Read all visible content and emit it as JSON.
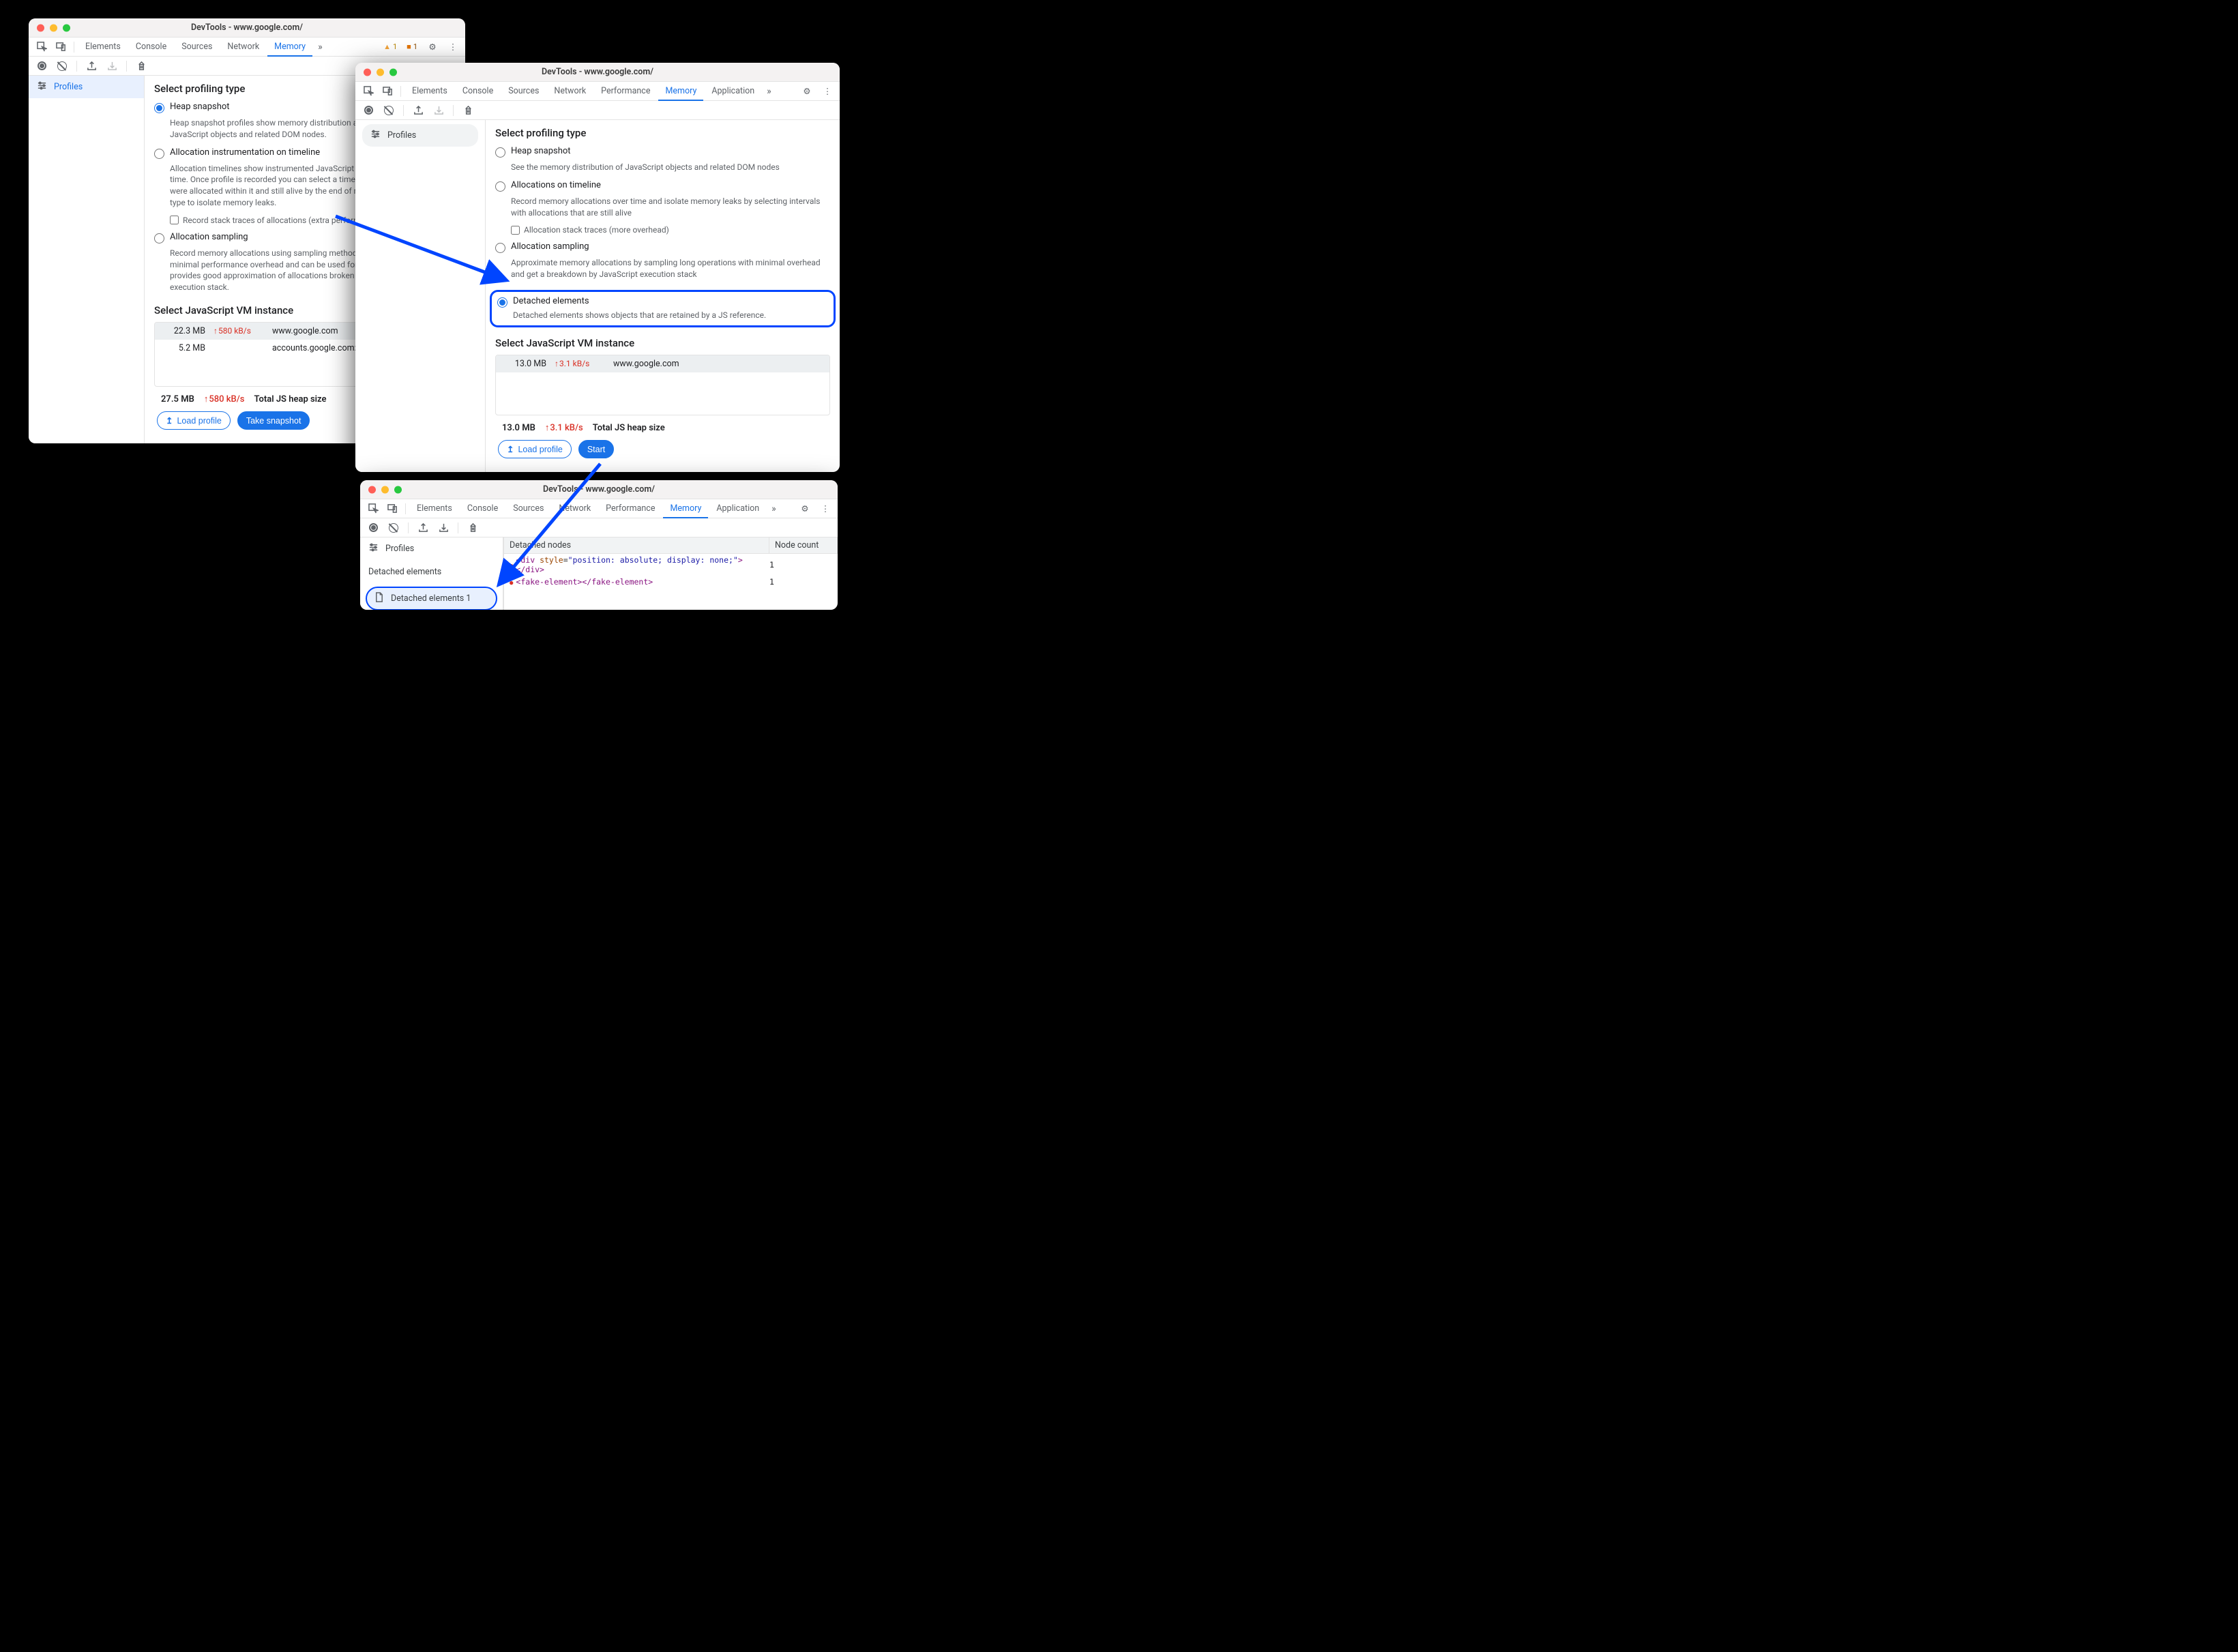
{
  "window1": {
    "title": "DevTools - www.google.com/",
    "tabs": [
      "Elements",
      "Console",
      "Sources",
      "Network",
      "Memory"
    ],
    "active_tab": "Memory",
    "warn_count": "1",
    "issue_count": "1",
    "sidebar": {
      "profiles": "Profiles"
    },
    "section_title": "Select profiling type",
    "options": [
      {
        "label": "Heap snapshot",
        "checked": true,
        "desc": "Heap snapshot profiles show memory distribution among your page's JavaScript objects and related DOM nodes."
      },
      {
        "label": "Allocation instrumentation on timeline",
        "checked": false,
        "desc": "Allocation timelines show instrumented JavaScript memory allocations over time. Once profile is recorded you can select a time interval to see objects that were allocated within it and still alive by the end of recording. Use this profile type to isolate memory leaks.",
        "sub_check": "Record stack traces of allocations (extra performance overhead)"
      },
      {
        "label": "Allocation sampling",
        "checked": false,
        "desc": "Record memory allocations using sampling method. This profile type has minimal performance overhead and can be used for long running operations. It provides good approximation of allocations broken down by JavaScript execution stack."
      }
    ],
    "vm_title": "Select JavaScript VM instance",
    "vms": [
      {
        "size": "22.3 MB",
        "rate": "580 kB/s",
        "host": "www.google.com",
        "selected": true
      },
      {
        "size": "5.2 MB",
        "rate": "",
        "host": "accounts.google.com: Rotate cookies",
        "selected": false
      }
    ],
    "footer": {
      "size": "27.5 MB",
      "rate": "580 kB/s",
      "label": "Total JS heap size",
      "load": "Load profile",
      "action": "Take snapshot"
    }
  },
  "window2": {
    "title": "DevTools - www.google.com/",
    "tabs": [
      "Elements",
      "Console",
      "Sources",
      "Network",
      "Performance",
      "Memory",
      "Application"
    ],
    "active_tab": "Memory",
    "sidebar": {
      "profiles": "Profiles"
    },
    "section_title": "Select profiling type",
    "options": [
      {
        "label": "Heap snapshot",
        "desc": "See the memory distribution of JavaScript objects and related DOM nodes"
      },
      {
        "label": "Allocations on timeline",
        "desc": "Record memory allocations over time and isolate memory leaks by selecting intervals with allocations that are still alive",
        "sub_check": "Allocation stack traces (more overhead)"
      },
      {
        "label": "Allocation sampling",
        "desc": "Approximate memory allocations by sampling long operations with minimal overhead and get a breakdown by JavaScript execution stack"
      },
      {
        "label": "Detached elements",
        "desc": "Detached elements shows objects that are retained by a JS reference.",
        "checked": true,
        "highlight": true
      }
    ],
    "vm_title": "Select JavaScript VM instance",
    "vms": [
      {
        "size": "13.0 MB",
        "rate": "3.1 kB/s",
        "host": "www.google.com",
        "selected": true
      }
    ],
    "footer": {
      "size": "13.0 MB",
      "rate": "3.1 kB/s",
      "label": "Total JS heap size",
      "load": "Load profile",
      "action": "Start"
    }
  },
  "window3": {
    "title": "DevTools - www.google.com/",
    "tabs": [
      "Elements",
      "Console",
      "Sources",
      "Network",
      "Performance",
      "Memory",
      "Application"
    ],
    "active_tab": "Memory",
    "sidebar": {
      "profiles": "Profiles",
      "category": "Detached elements",
      "entry": "Detached elements 1"
    },
    "table": {
      "head1": "Detached nodes",
      "head2": "Node count",
      "rows": [
        {
          "html": "<div style=\"position: absolute; display: none;\"></div>",
          "count": "1"
        },
        {
          "html": "<fake-element></fake-element>",
          "count": "1"
        }
      ]
    }
  }
}
